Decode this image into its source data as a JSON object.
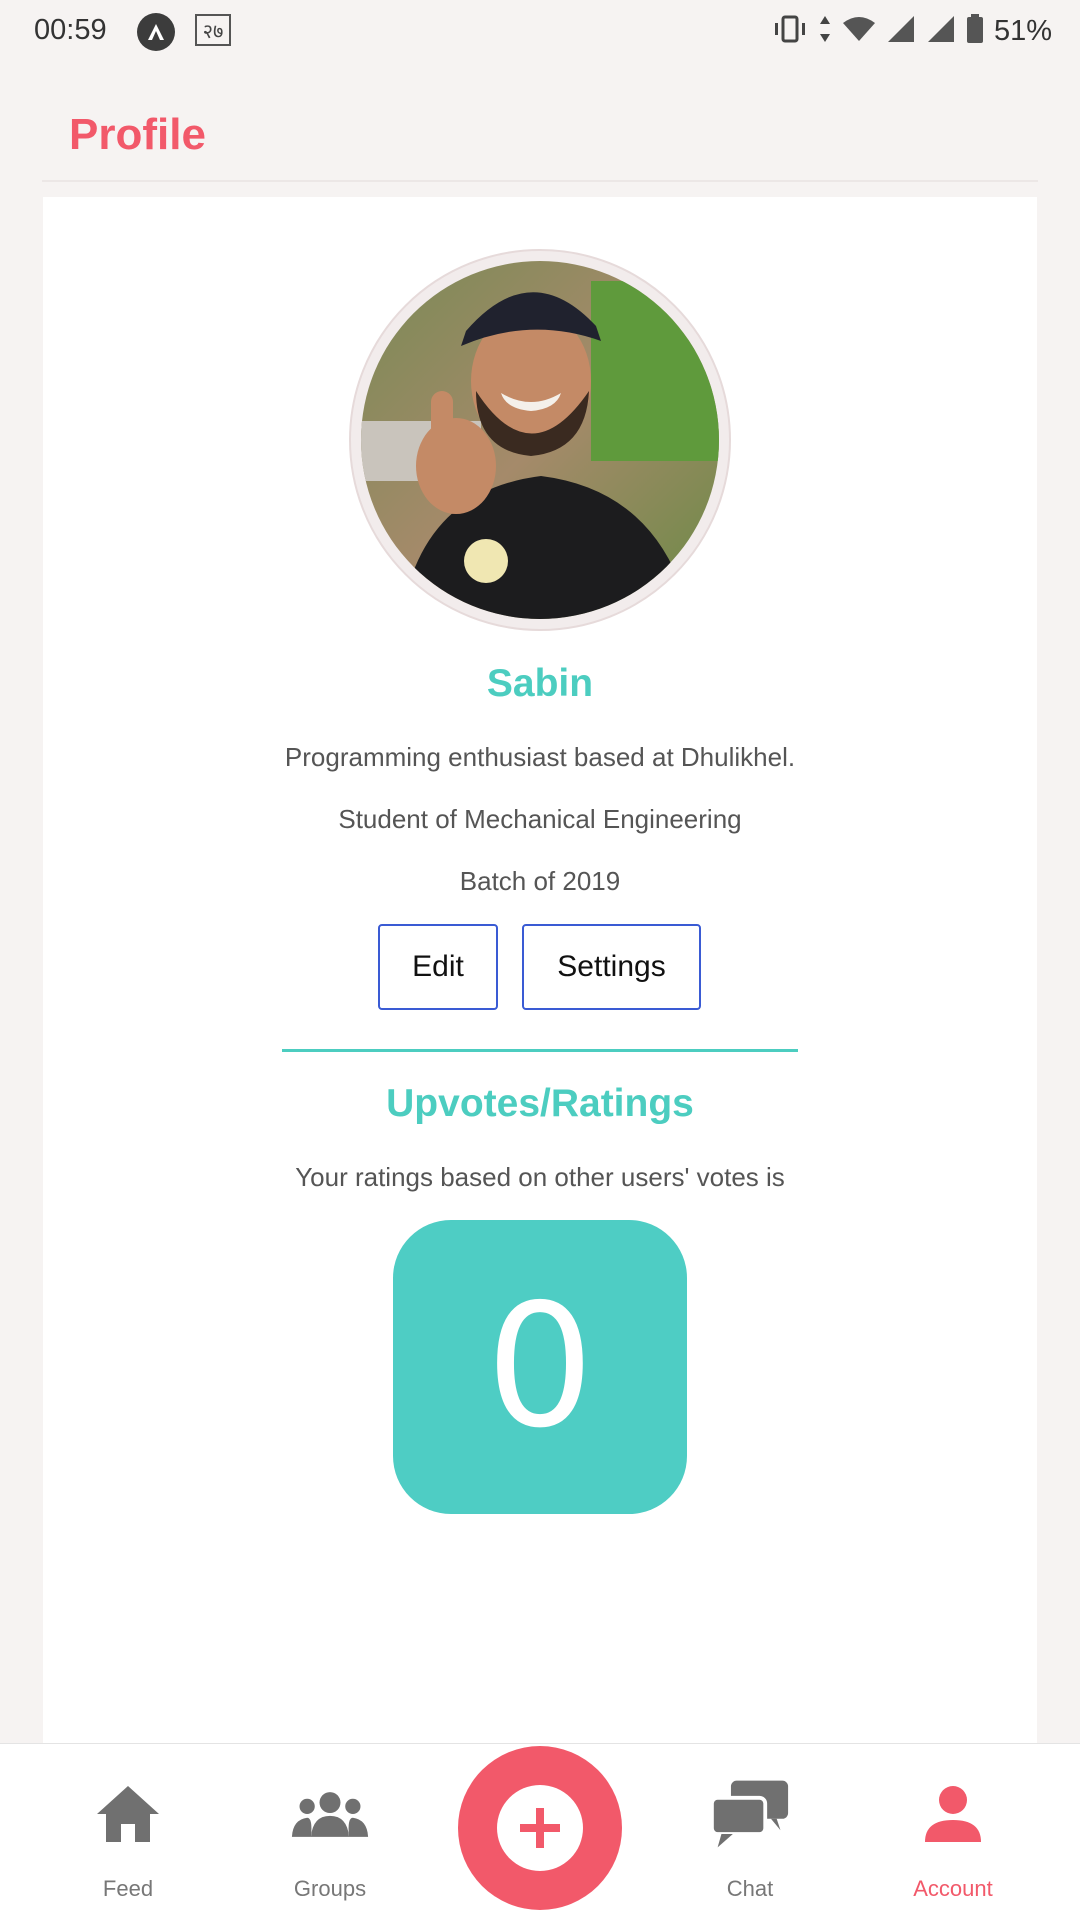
{
  "status_bar": {
    "time": "00:59",
    "rt_badge": "२७",
    "battery": "51%"
  },
  "header": {
    "title": "Profile"
  },
  "profile": {
    "name": "Sabin",
    "bio_lines": [
      "Programming enthusiast based at Dhulikhel.",
      "Student of Mechanical Engineering",
      "Batch of 2019"
    ],
    "edit_label": "Edit",
    "settings_label": "Settings"
  },
  "ratings": {
    "title": "Upvotes/Ratings",
    "description": "Your ratings based on other users' votes is",
    "value": "0"
  },
  "bottom_nav": {
    "items": [
      {
        "label": "Feed",
        "icon": "home-icon"
      },
      {
        "label": "Groups",
        "icon": "groups-icon"
      },
      {
        "label": "",
        "icon": "plus-icon"
      },
      {
        "label": "Chat",
        "icon": "chat-icon"
      },
      {
        "label": "Account",
        "icon": "account-icon"
      }
    ],
    "active": "Account"
  },
  "colors": {
    "accent_red": "#f2596a",
    "accent_teal": "#4ccdc0",
    "button_border": "#3a5bd4",
    "background": "#f6f3f2"
  }
}
